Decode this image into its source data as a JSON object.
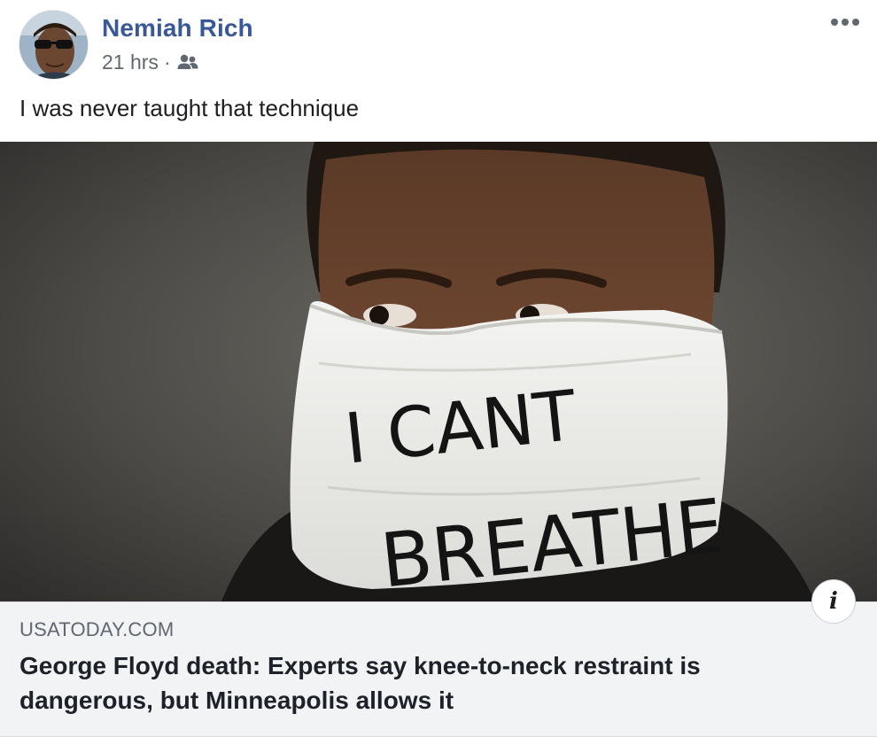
{
  "post": {
    "author": {
      "name": "Nemiah Rich",
      "avatar_icon": "user-avatar"
    },
    "timestamp": "21 hrs",
    "separator": "·",
    "audience_icon": "friends-icon",
    "more_icon": "more-options-icon",
    "text": "I was never taught that technique"
  },
  "link_preview": {
    "image": {
      "mask_text_line1": "I CANT",
      "mask_text_line2": "BREATHE"
    },
    "info_label": "i",
    "domain": "USATODAY.COM",
    "title": "George Floyd death: Experts say knee-to-neck restraint is dangerous, but Minneapolis allows it"
  },
  "colors": {
    "author_name": "#385898",
    "meta_text": "#606770",
    "caption_bg": "#f2f3f5",
    "title_text": "#1d2129"
  }
}
